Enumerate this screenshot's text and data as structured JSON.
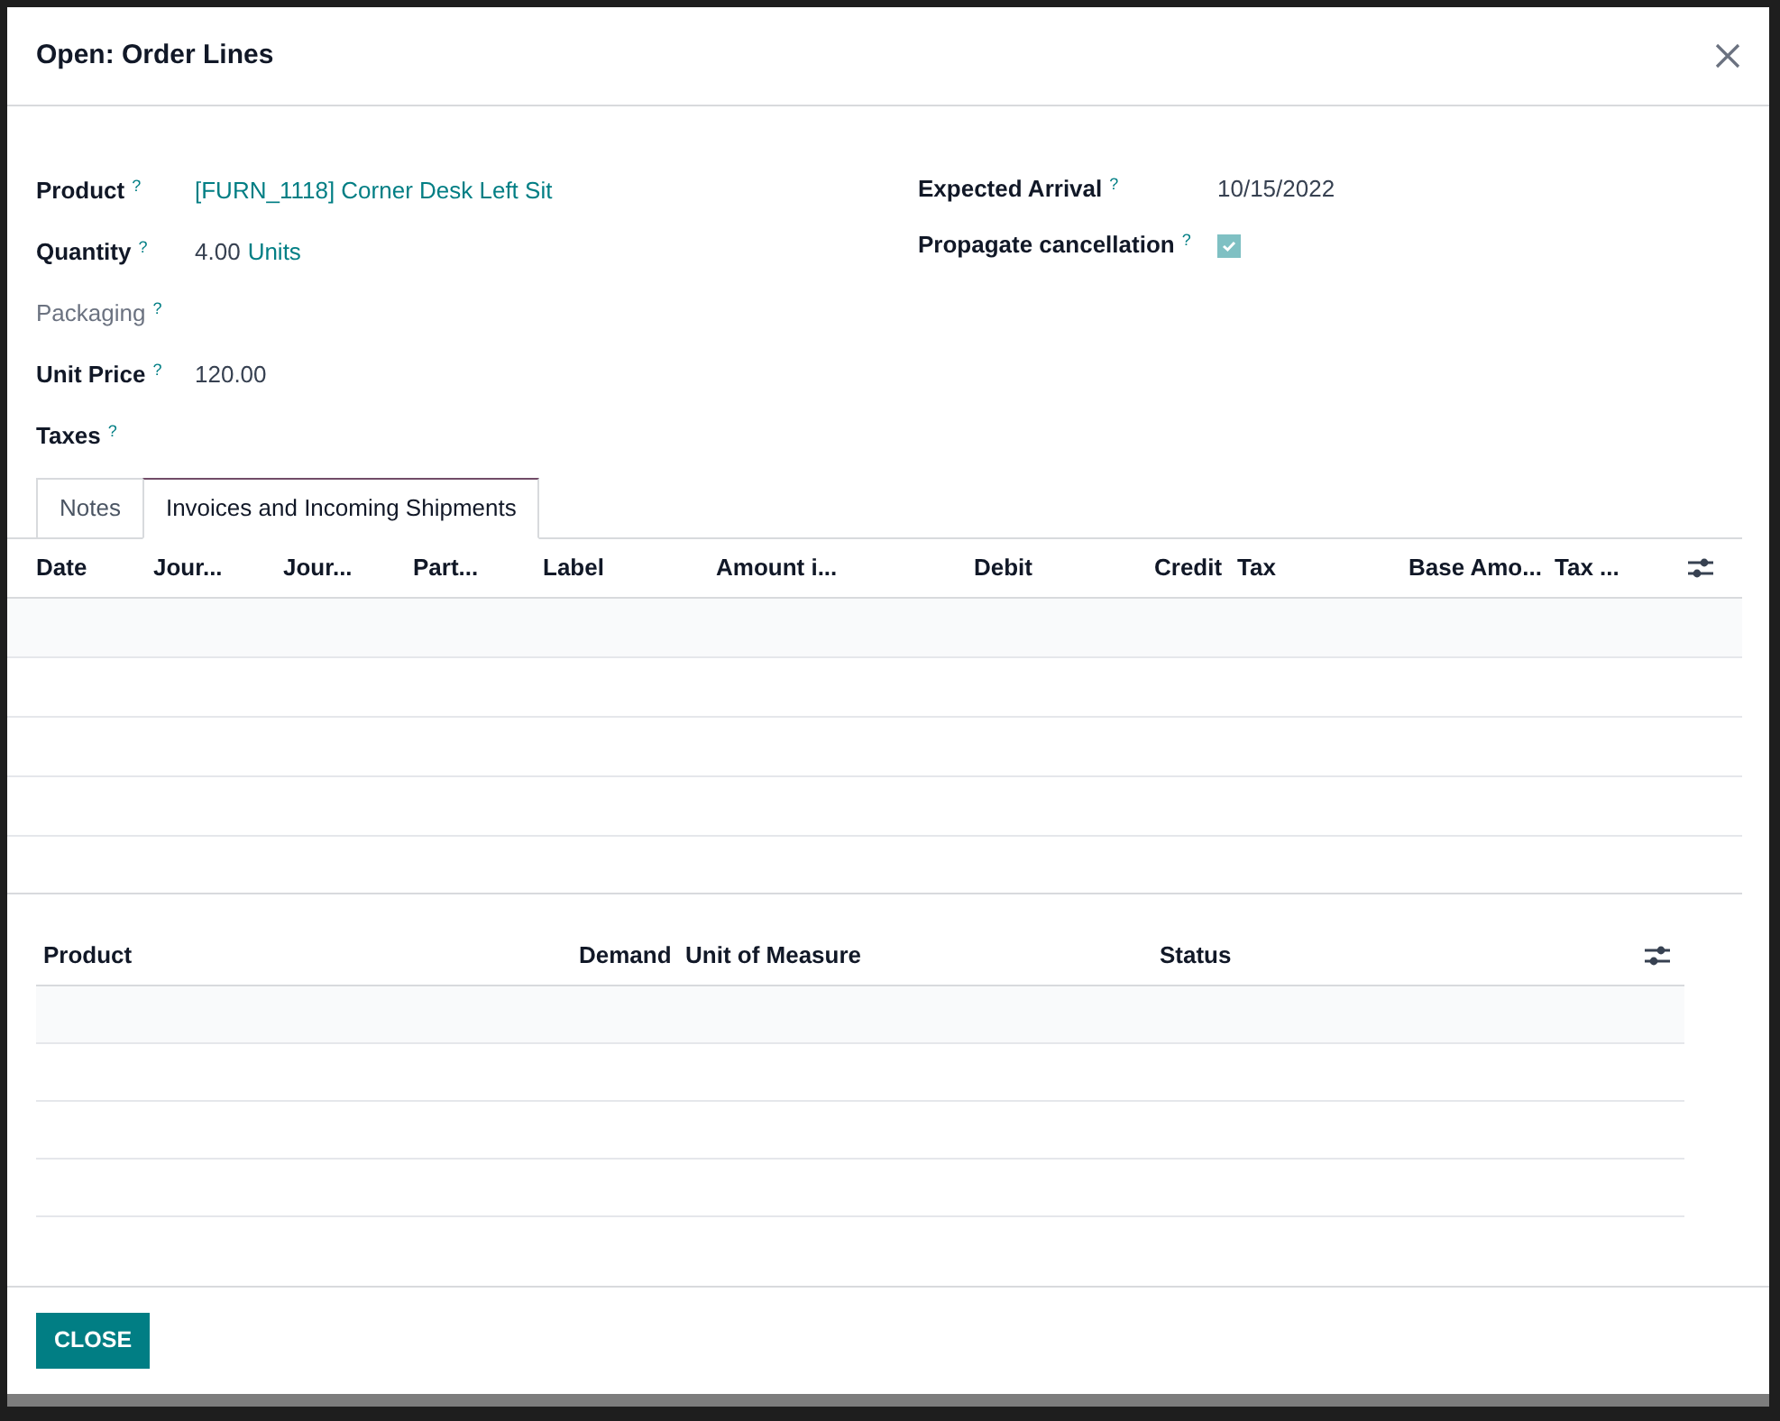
{
  "dialog": {
    "title": "Open: Order Lines"
  },
  "left_fields": [
    {
      "label": "Product",
      "help": "?",
      "value": "[FURN_1118] Corner Desk Left Sit",
      "kind": "link",
      "muted": false
    },
    {
      "label": "Quantity",
      "help": "?",
      "value": "4.00",
      "unit": "Units",
      "kind": "quantity",
      "muted": false
    },
    {
      "label": "Packaging",
      "help": "?",
      "kind": "empty",
      "muted": true
    },
    {
      "label": "Unit Price",
      "help": "?",
      "value": "120.00",
      "kind": "text",
      "muted": false
    },
    {
      "label": "Taxes",
      "help": "?",
      "kind": "empty",
      "muted": false
    }
  ],
  "right_fields": [
    {
      "label": "Expected Arrival",
      "help": "?",
      "value": "10/15/2022",
      "kind": "text",
      "muted": false
    },
    {
      "label": "Propagate cancellation",
      "help": "?",
      "kind": "checkbox",
      "checked": true,
      "muted": false
    }
  ],
  "tabs": [
    {
      "label": "Notes",
      "selected": false
    },
    {
      "label": "Invoices and Incoming Shipments",
      "selected": true
    }
  ],
  "invoice_table": {
    "columns": [
      {
        "label": "Date"
      },
      {
        "label": "Jour..."
      },
      {
        "label": "Jour..."
      },
      {
        "label": "Part..."
      },
      {
        "label": "Label"
      },
      {
        "label": "Amount i..."
      },
      {
        "label": "Debit"
      },
      {
        "label": "Credit"
      },
      {
        "label": "Tax"
      },
      {
        "label": "Base Amo..."
      },
      {
        "label": "Tax ..."
      }
    ]
  },
  "moves_table": {
    "columns": [
      {
        "label": "Product"
      },
      {
        "label": "Demand"
      },
      {
        "label": "Unit of Measure"
      },
      {
        "label": "Status"
      }
    ]
  },
  "footer": {
    "button": "CLOSE"
  }
}
